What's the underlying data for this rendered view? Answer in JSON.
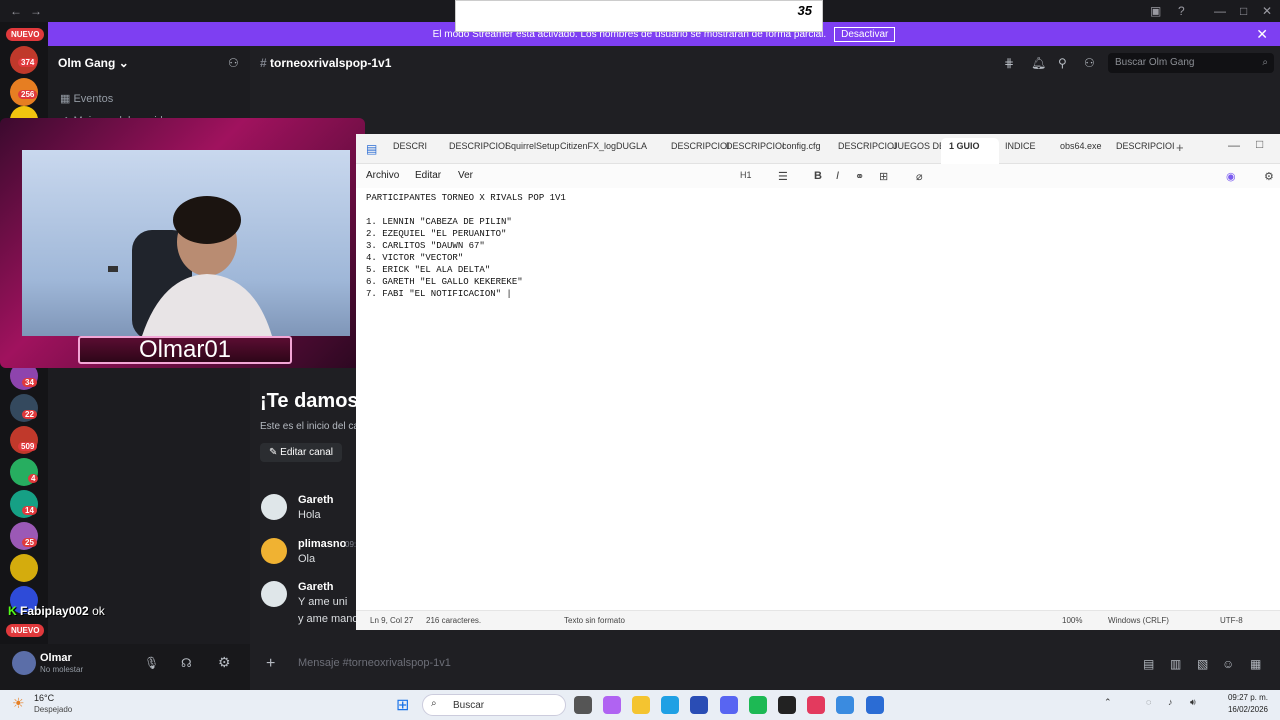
{
  "window": {
    "back": "←",
    "forward": "→"
  },
  "banner": {
    "text": "El modo Streamer está activado. Los nombres de usuario se mostrarán de forma parcial.",
    "button": "Desactivar",
    "close": "✕",
    "overlay_num": "35"
  },
  "rail": {
    "nuevo_top": "NUEVO",
    "nuevo_bottom": "NUEVO",
    "counts": [
      "374",
      "256",
      "34",
      "22",
      "509",
      "4",
      "14",
      "25"
    ]
  },
  "server": {
    "name": "Olm Gang",
    "chevron": "⌄",
    "events": "Eventos",
    "boosts": "Mejoras del servidor"
  },
  "channel": {
    "name": "torneoxrivalspop-1v1",
    "hash": "#",
    "search_placeholder": "Buscar Olm Gang"
  },
  "welcome": {
    "title": "¡Te damos",
    "subtitle": "Este es el inicio del ca",
    "edit": "Editar canal"
  },
  "messages": [
    {
      "name": "Gareth",
      "text": "Hola"
    },
    {
      "name": "plimasno",
      "time": "09:",
      "text": "Ola"
    },
    {
      "name": "Gareth",
      "text": "Y ame uni",
      "text2": "y ame manda"
    }
  ],
  "webcam": {
    "name": "Olmar01"
  },
  "chat_overlay": {
    "user": "Fabiplay002",
    "text": "ok"
  },
  "user": {
    "name": "Olmar",
    "status": "No molestar"
  },
  "composer": {
    "placeholder": "Mensaje #torneoxrivalspop-1v1"
  },
  "notepad": {
    "tabs": [
      "DESCRI",
      "DESCRIPCIOI",
      "SquirrelSetup",
      "CitizenFX_log",
      "DUGLA",
      "DESCRIPCIOI",
      "DESCRIPCIOI",
      "config.cfg",
      "DESCRIPCIOI",
      "JUEGOS DEL",
      "1 GUIO",
      "INDICE",
      "obs64.exe",
      "DESCRIPCIOI"
    ],
    "menu": [
      "Archivo",
      "Editar",
      "Ver"
    ],
    "heading": "H1",
    "content": "PARTICIPANTES TORNEO X RIVALS POP 1V1\n\n1. LENNIN \"CABEZA DE PILIN\"\n2. EZEQUIEL \"EL PERUANITO\"\n3. CARLITOS \"DAUWN 67\"\n4. VICTOR \"VECTOR\"\n5. ERICK \"EL ALA DELTA\"\n6. GARETH \"EL GALLO KEKEREKE\"\n7. FABI \"EL NOTIFICACION\" |",
    "status": {
      "pos": "Ln 9, Col 27",
      "chars": "216 caracteres.",
      "format": "Texto sin formato",
      "zoom": "100%",
      "eol": "Windows (CRLF)",
      "enc": "UTF-8"
    }
  },
  "taskbar": {
    "temp": "16°C",
    "weather": "Despejado",
    "search": "Buscar",
    "time": "09:27 p. m.",
    "date": "16/02/2026"
  },
  "colors": {
    "accent": "#7e3ff2",
    "alert": "#e0393c"
  }
}
